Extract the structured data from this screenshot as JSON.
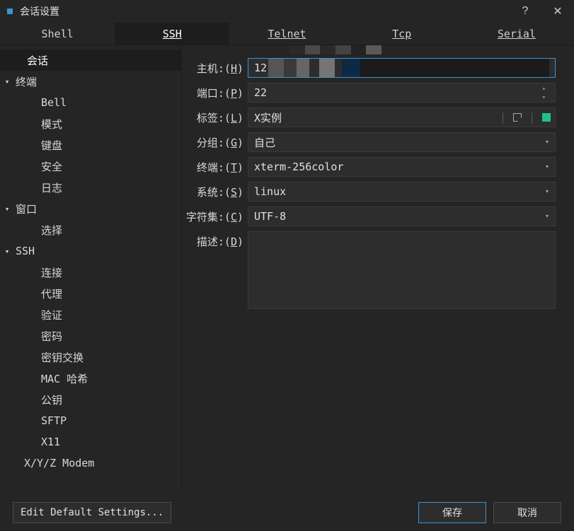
{
  "window": {
    "title": "会话设置",
    "help": "?",
    "close": "✕"
  },
  "tabs": {
    "shell": "Shell",
    "ssh": "SSH",
    "telnet": "Telnet",
    "tcp": "Tcp",
    "serial": "Serial",
    "active": "ssh"
  },
  "sidebar": {
    "session": "会话",
    "terminal": "终端",
    "terminal_items": {
      "bell": "Bell",
      "mode": "模式",
      "keyboard": "键盘",
      "security": "安全",
      "log": "日志"
    },
    "window": "窗口",
    "window_items": {
      "select": "选择"
    },
    "ssh": "SSH",
    "ssh_items": {
      "connect": "连接",
      "proxy": "代理",
      "auth": "验证",
      "password": "密码",
      "kex": "密钥交换",
      "mac": "MAC 哈希",
      "pubkey": "公钥",
      "sftp": "SFTP",
      "x11": "X11"
    },
    "modem": "X/Y/Z Modem"
  },
  "form": {
    "host_label": "主机",
    "host_key": "H",
    "host_value": "12",
    "port_label": "端口",
    "port_key": "P",
    "port_value": "22",
    "label_label": "标签",
    "label_key": "L",
    "label_value": "X实例",
    "group_label": "分组",
    "group_key": "G",
    "group_value": "自己",
    "term_label": "终端",
    "term_key": "T",
    "term_value": "xterm-256color",
    "system_label": "系统",
    "system_key": "S",
    "system_value": "linux",
    "charset_label": "字符集",
    "charset_key": "C",
    "charset_value": "UTF-8",
    "desc_label": "描述",
    "desc_key": "D",
    "desc_value": ""
  },
  "footer": {
    "edit_defaults": "Edit Default Settings...",
    "save": "保存",
    "cancel": "取消"
  },
  "colors": {
    "accent": "#3a94d6",
    "green": "#23c18a"
  }
}
